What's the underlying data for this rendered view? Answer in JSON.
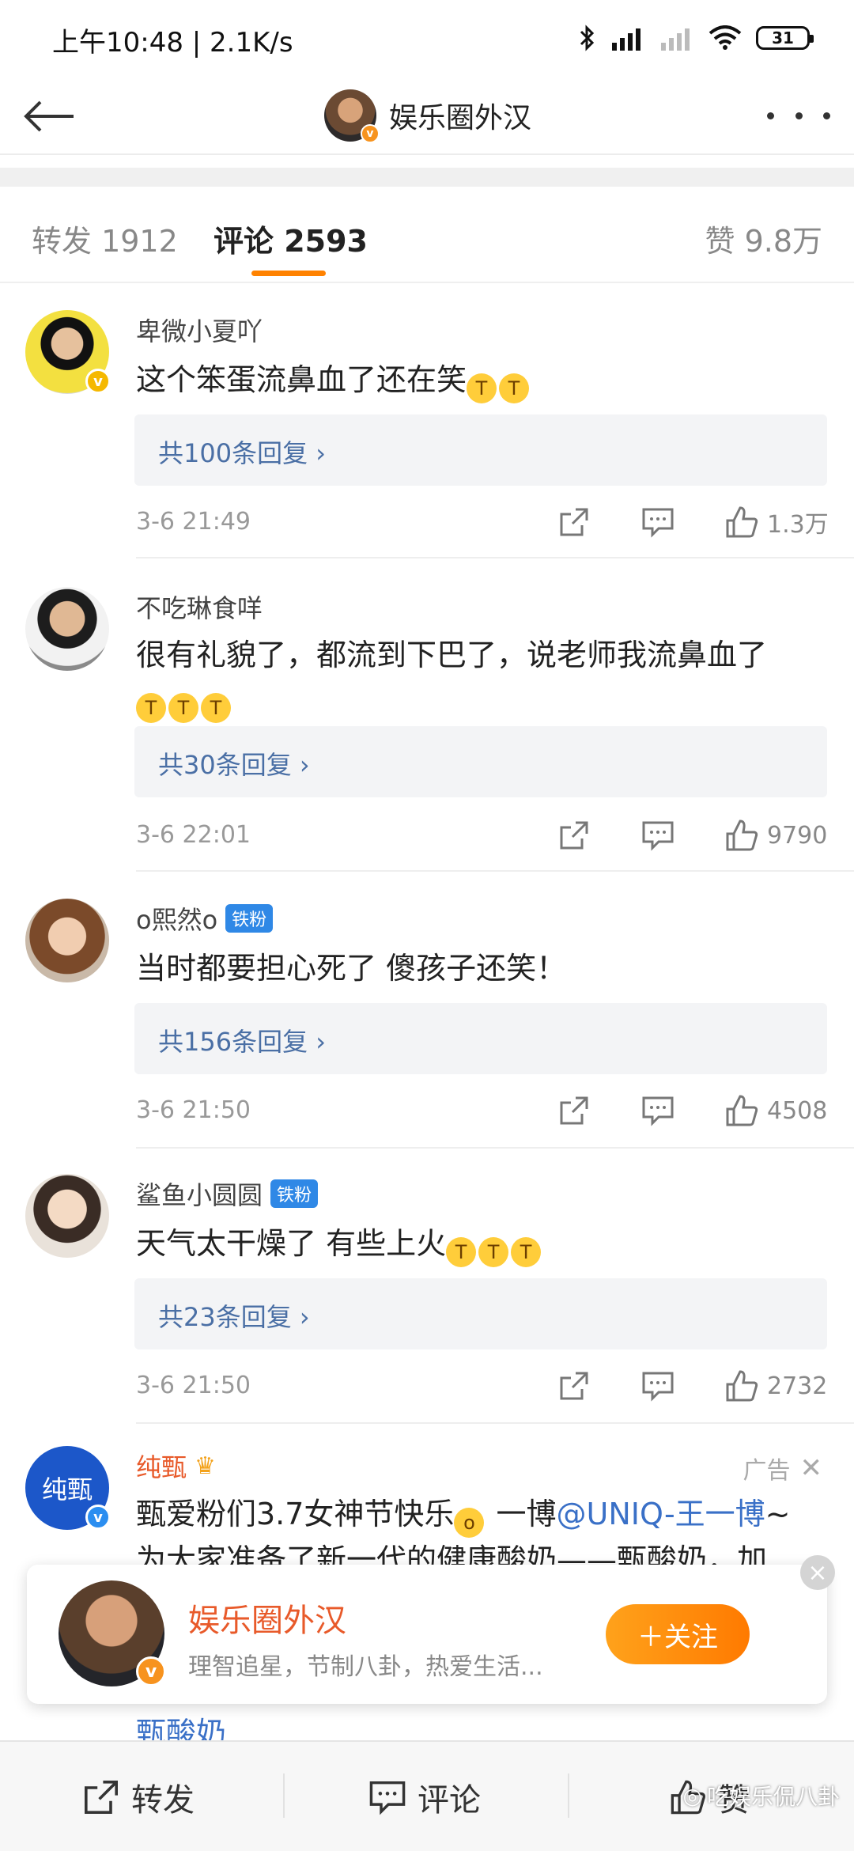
{
  "status_bar": {
    "time_speed": "上午10:48 | 2.1K/s",
    "battery": "31"
  },
  "header": {
    "title": "娱乐圈外汉"
  },
  "tabs": [
    {
      "label": "转发 1912"
    },
    {
      "label": "评论 2593"
    },
    {
      "label": "赞 9.8万"
    }
  ],
  "comments": [
    {
      "user": "卑微小夏吖",
      "text": "这个笨蛋流鼻血了还在笑",
      "emoji_count": 2,
      "replies": "共100条回复 ›",
      "time": "3-6 21:49",
      "likes": "1.3万"
    },
    {
      "user": "不吃琳食咩",
      "text": "很有礼貌了，都流到下巴了，说老师我流鼻血了",
      "emoji_count": 3,
      "replies": "共30条回复 ›",
      "time": "3-6 22:01",
      "likes": "9790"
    },
    {
      "user": "o熙然o",
      "badge": "铁粉",
      "text": "当时都要担心死了 傻孩子还笑！",
      "replies": "共156条回复 ›",
      "time": "3-6 21:50",
      "likes": "4508"
    },
    {
      "user": "鲨鱼小圆圆",
      "badge": "铁粉",
      "text": "天气太干燥了 有些上火",
      "emoji_count": 3,
      "replies": "共23条回复 ›",
      "time": "3-6 21:50",
      "likes": "2732"
    }
  ],
  "ad": {
    "user": "纯甄",
    "avatar_text": "纯甄",
    "label": "广告",
    "line1_pre": "甄爱粉们3.7女神节快乐",
    "line1_mid": " 一博",
    "mention": "@UNIQ-王一博",
    "line1_post": "~",
    "line2": "为大家准备了新一代的健康酸奶——甄酸奶，加",
    "peek": "甄酸奶"
  },
  "follow_card": {
    "name": "娱乐圈外汉",
    "desc": "理智追星，节制八卦，热爱生活...",
    "button": "＋关注"
  },
  "bottom_bar": {
    "repost": "转发",
    "comment": "评论",
    "like": "赞"
  },
  "watermark": "吃娱乐侃八卦",
  "colors": {
    "accent": "#ff8200",
    "link": "#4a6fa5",
    "ad_name": "#e85a2a"
  }
}
